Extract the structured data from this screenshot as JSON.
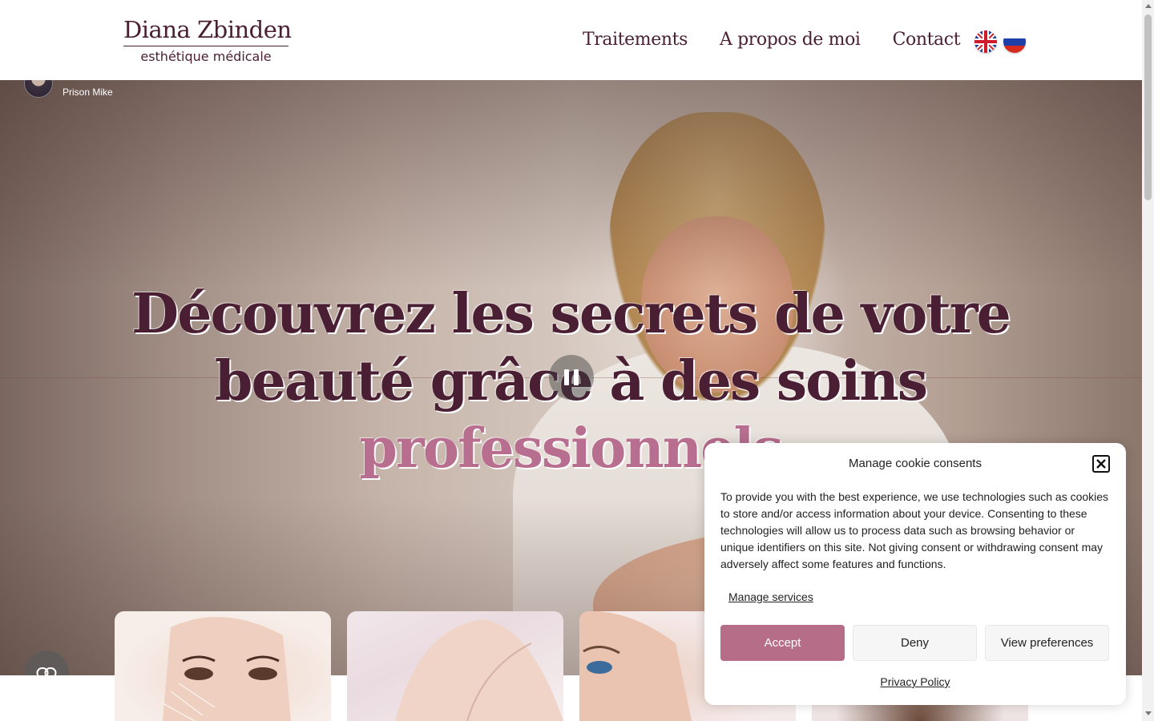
{
  "header": {
    "logo_name": "Diana Zbinden",
    "logo_sub": "esthétique médicale",
    "nav": [
      {
        "label": "Traitements"
      },
      {
        "label": "A propos de moi"
      },
      {
        "label": "Contact"
      }
    ],
    "flags": [
      "uk-flag-icon",
      "russia-flag-icon"
    ]
  },
  "hero": {
    "channel_subtitle": "Prison Mike",
    "headline_line1": "Découvrez les secrets de votre",
    "headline_line2": "beauté grâce à des soins",
    "headline_accent": "professionnels",
    "icons": [
      "pause-icon",
      "link-icon"
    ]
  },
  "cookie": {
    "title": "Manage cookie consents",
    "body": "To provide you with the best experience, we use technologies such as cookies to store and/or access information about your device. Consenting to these technologies will allow us to process data such as browsing behavior or unique identifiers on this site. Not giving consent or withdrawing consent may adversely affect some features and functions.",
    "manage_services": "Manage services",
    "accept": "Accept",
    "deny": "Deny",
    "view_preferences": "View preferences",
    "privacy_policy": "Privacy Policy"
  },
  "colors": {
    "brand": "#4a1f33",
    "accent": "#b86e8e",
    "accept_button": "#b66d88"
  }
}
